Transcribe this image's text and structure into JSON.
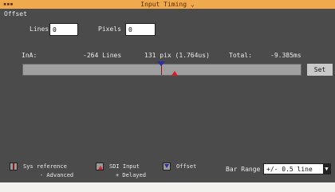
{
  "window": {
    "menu": "▪▪▪",
    "title": "Input Timing"
  },
  "offset": {
    "section_label": "Offset",
    "lines_label": "Lines",
    "lines_value": "0",
    "pixels_label": "Pixels",
    "pixels_value": "0"
  },
  "inA": {
    "label": "InA:",
    "lines_value": "-264 Lines",
    "pix_value": "131 pix (1.764us)",
    "total_label": "Total:",
    "total_value": "-9.385ms"
  },
  "buttons": {
    "set_label": "Set"
  },
  "legend": {
    "sys_reference": "Sys reference",
    "sdi_input": "SDI Input",
    "offset": "Offset",
    "advanced": "- Advanced",
    "delayed": "+ Delayed",
    "bar_range_label": "Bar Range",
    "bar_range_value": "+/- 0.5 line"
  },
  "colors": {
    "titlebar": "#f0a94c",
    "window_bg": "#4b4b4b",
    "sys_reference": "#8a1a1a",
    "sdi_input": "#d92020",
    "offset_marker": "#2d2da6"
  }
}
